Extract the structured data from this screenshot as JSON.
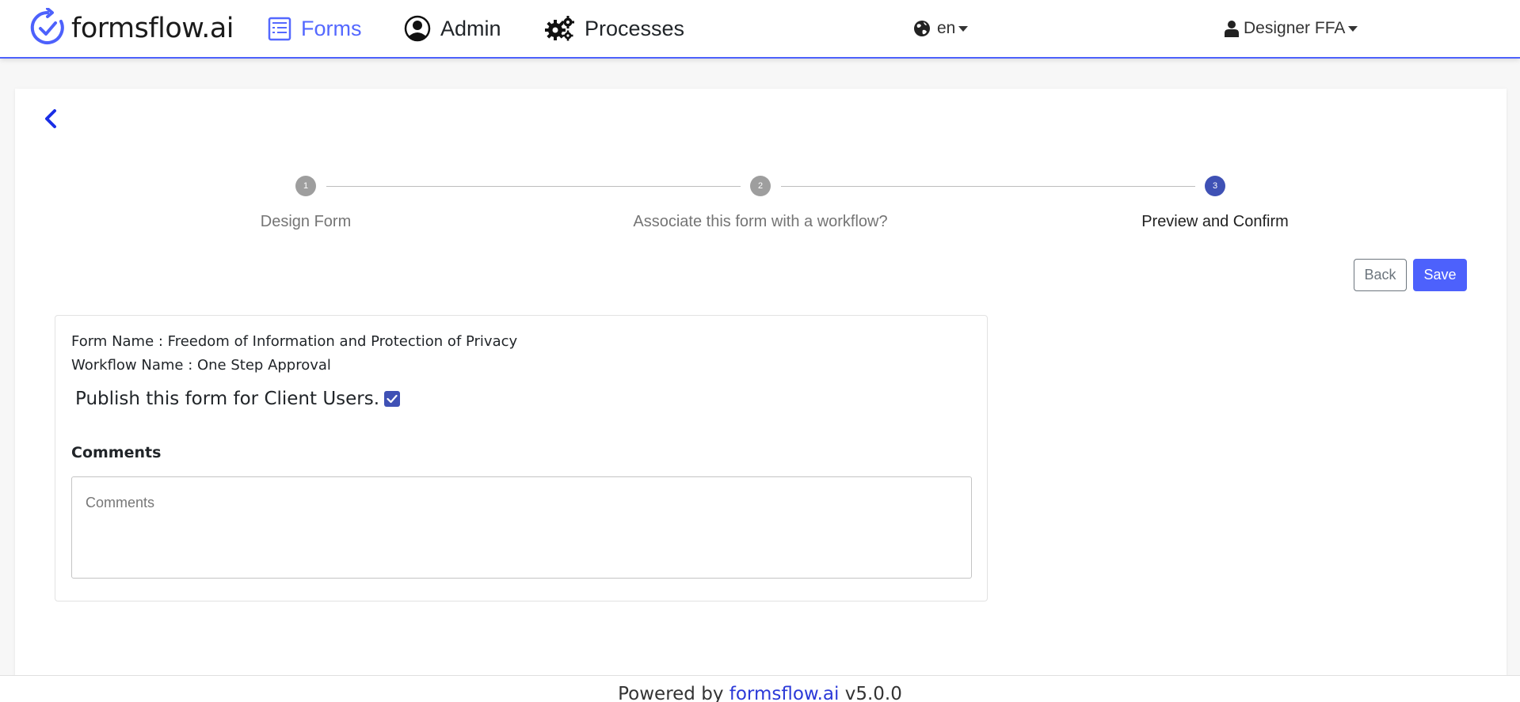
{
  "navbar": {
    "brand": "formsflow.ai",
    "items": [
      {
        "label": "Forms",
        "icon": "form-list-icon",
        "active": true
      },
      {
        "label": "Admin",
        "icon": "user-circle-icon",
        "active": false
      },
      {
        "label": "Processes",
        "icon": "gears-icon",
        "active": false
      }
    ],
    "language": "en",
    "user": "Designer FFA"
  },
  "stepper": {
    "steps": [
      {
        "number": "1",
        "label": "Design Form",
        "active": false
      },
      {
        "number": "2",
        "label": "Associate this form with a workflow?",
        "active": false
      },
      {
        "number": "3",
        "label": "Preview and Confirm",
        "active": true
      }
    ]
  },
  "actions": {
    "back_label": "Back",
    "save_label": "Save"
  },
  "summary": {
    "form_name_line": "Form Name : Freedom of Information and Protection of Privacy",
    "workflow_name_line": "Workflow Name : One Step Approval",
    "publish_label": "Publish this form for Client Users.",
    "publish_checked": true,
    "comments_label": "Comments",
    "comments_placeholder": "Comments",
    "comments_value": ""
  },
  "footer": {
    "prefix": "Powered by",
    "link": "formsflow.ai",
    "version": "v5.0.0"
  },
  "colors": {
    "accent": "#4d61fc",
    "step_active": "#3f51b5",
    "step_inactive": "#9e9e9e"
  }
}
